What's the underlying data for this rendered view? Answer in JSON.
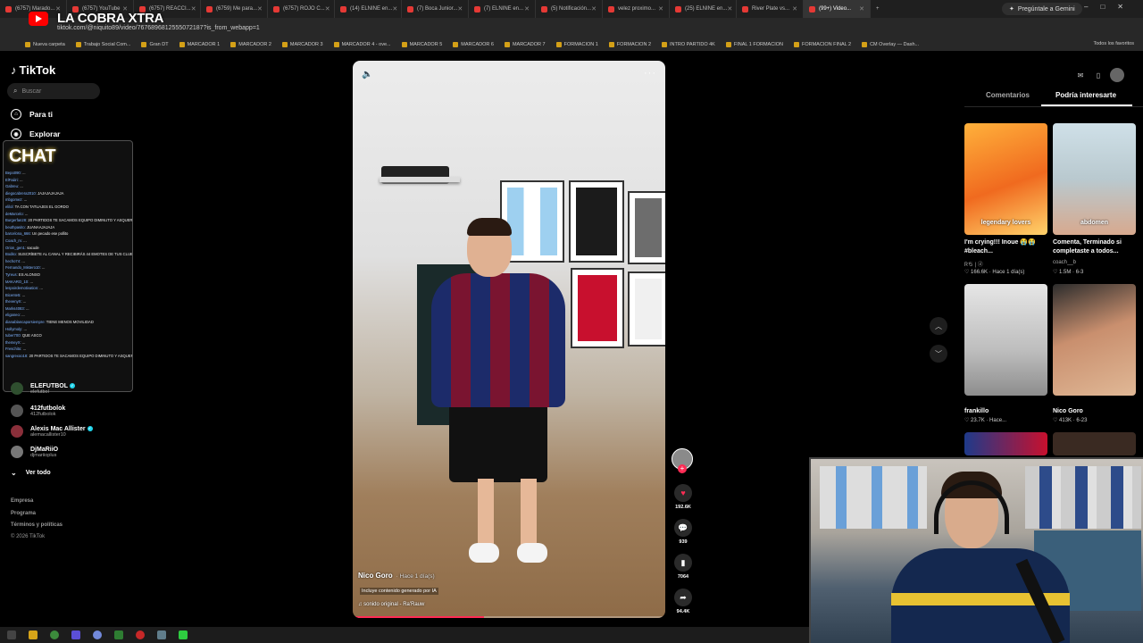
{
  "browser": {
    "tabs": [
      {
        "label": "(6757) Marado..."
      },
      {
        "label": "(6757) YouTube"
      },
      {
        "label": "(6757) REACCI..."
      },
      {
        "label": "(6759) Me para..."
      },
      {
        "label": "(6757) ROJO C..."
      },
      {
        "label": "(14) ELNINE en..."
      },
      {
        "label": "(7) Boca Junior..."
      },
      {
        "label": "(7) ELNINE en..."
      },
      {
        "label": "(5) Notificación..."
      },
      {
        "label": "velez proximo..."
      },
      {
        "label": "(25) ELNINE en..."
      },
      {
        "label": "River Plate vs..."
      },
      {
        "label": "(99+) Video..."
      }
    ],
    "gemini_label": "Pregúntale a Gemini",
    "url": "tiktok.com/@niquito89/video/7676896812555072187?is_from_webapp=1",
    "bookmarks": [
      "Nueva carpeta",
      "Trabajo Social Com...",
      "Gran DT",
      "MARCADOR 1",
      "MARCADOR 2",
      "MARCADOR 3",
      "MARCADOR 4 - ove...",
      "MARCADOR 5",
      "MARCADOR 6",
      "MARCADOR 7",
      "FORMACION 1",
      "FORMACION 2",
      "INTRO PARTIDO 4K",
      "FINAL 1 FORMACION",
      "FORMACION FINAL 2",
      "CM Overlay — Dash..."
    ],
    "bookmarks_all": "Todos los favoritos"
  },
  "stream_overlay": {
    "title": "LA COBRA XTRA",
    "chat_title": "CHAT",
    "chat_lines": [
      {
        "user": "Bepo090:",
        "text": "..."
      },
      {
        "user": "ElFaiiiri:",
        "text": "..."
      },
      {
        "user": "Gabreu:",
        "text": "..."
      },
      {
        "user": "diegocabrera2010:",
        "text": "JAJAJAJAJAJA"
      },
      {
        "user": "mbgomez:",
        "text": "..."
      },
      {
        "user": "elilol:",
        "text": "TA CON TATUAJES EL GORDO"
      },
      {
        "user": "deMarcelo:",
        "text": "..."
      },
      {
        "user": "Burgerfan28:",
        "text": "20 PARTIDOS TE SACAMOS EQUIPO DIMINUTO Y ASQUEROSO"
      },
      {
        "user": "beuthpasito:",
        "text": "JUANAAJAJAJA"
      },
      {
        "user": "barcelona_666:",
        "text": "Un pecado ese pollito"
      },
      {
        "user": "Coach_m:",
        "text": "..."
      },
      {
        "user": "Orion_gen1:",
        "text": "sacude"
      },
      {
        "user": "Bodito:",
        "text": "SUSCRÍBETE AL CANAL Y RECIBIRÁS 44 EMOTES DE TUS CLUBES FAVORITOS! Además ayudas al NINE!"
      },
      {
        "user": "hecho74:",
        "text": "..."
      },
      {
        "user": "Fernando_Mistero10:",
        "text": "..."
      },
      {
        "user": "Tyreus:",
        "text": "ES ALONSO"
      },
      {
        "user": "MAKARO_10:",
        "text": "..."
      },
      {
        "user": "lespoirdemotivation:",
        "text": "..."
      },
      {
        "user": "Bicente5:",
        "text": "..."
      },
      {
        "user": "thevenyX:",
        "text": "..."
      },
      {
        "user": "Marks4083:",
        "text": "..."
      },
      {
        "user": "eliganeo:",
        "text": "..."
      },
      {
        "user": "dianablancaporsiempre:",
        "text": "TIENE MENOS MOVILIDAD"
      },
      {
        "user": "Hollymoly:",
        "text": "..."
      },
      {
        "user": "tuber700:",
        "text": "QUE ASCO"
      },
      {
        "user": "themeyX:",
        "text": "..."
      },
      {
        "user": "Freschito:",
        "text": "..."
      },
      {
        "user": "sangrexoo18:",
        "text": "20 PARTIDOS TE SACAMOS EQUIPO DIMINUTO Y ASQUEROSO"
      }
    ]
  },
  "tiktok": {
    "logo": "TikTok",
    "search_placeholder": "Buscar",
    "nav": [
      {
        "label": "Para ti"
      },
      {
        "label": "Explorar"
      }
    ],
    "following": [
      {
        "name": "ELEFUTBOL",
        "handle": "elefutbol",
        "verified": true
      },
      {
        "name": "412futbolok",
        "handle": "412futbolok",
        "verified": false
      },
      {
        "name": "Alexis Mac Allister",
        "handle": "alemacallister10",
        "verified": true
      },
      {
        "name": "DjMaRiiO",
        "handle": "djmariioplus",
        "verified": false
      }
    ],
    "see_all": "Ver todo",
    "footer": [
      "Empresa",
      "Programa",
      "Términos y políticas",
      "© 2026 TikTok"
    ]
  },
  "video": {
    "author": "Nico Goro",
    "posted": "· Hace 1 día(s)",
    "ai_label": "Incluye contenido generado por IA",
    "sound": "sonido original - Ra'Rauw",
    "progress": 0.42,
    "likes": "192.6K",
    "comments": "939",
    "saves": "7064",
    "shares": "94.4K"
  },
  "right_panel": {
    "tab_comments": "Comentarios",
    "tab_interest": "Podría interesarte",
    "items": [
      {
        "caption": "I'm crying!!! Inoue 😭😭 #bleach...",
        "user": "Ꮢち | ⓓ",
        "meta": "♡ 166.6K · Hace 1 día(s)",
        "overlay": "legendary lovers"
      },
      {
        "caption": "Comenta, Terminado si completaste a todos...",
        "user": "coach__b",
        "meta": "♡ 1.5M · 6-3",
        "overlay": "abdomen"
      },
      {
        "caption": "",
        "user": "frankillo",
        "meta": "♡ 23.7K · Hace...",
        "overlay": ""
      },
      {
        "caption": "",
        "user": "Nico Goro",
        "meta": "♡ 413K · 6-23",
        "overlay": ""
      }
    ]
  },
  "colors": {
    "accent": "#fe2c55",
    "verified": "#20d5ec",
    "chat_glow": "#ffd84d"
  }
}
